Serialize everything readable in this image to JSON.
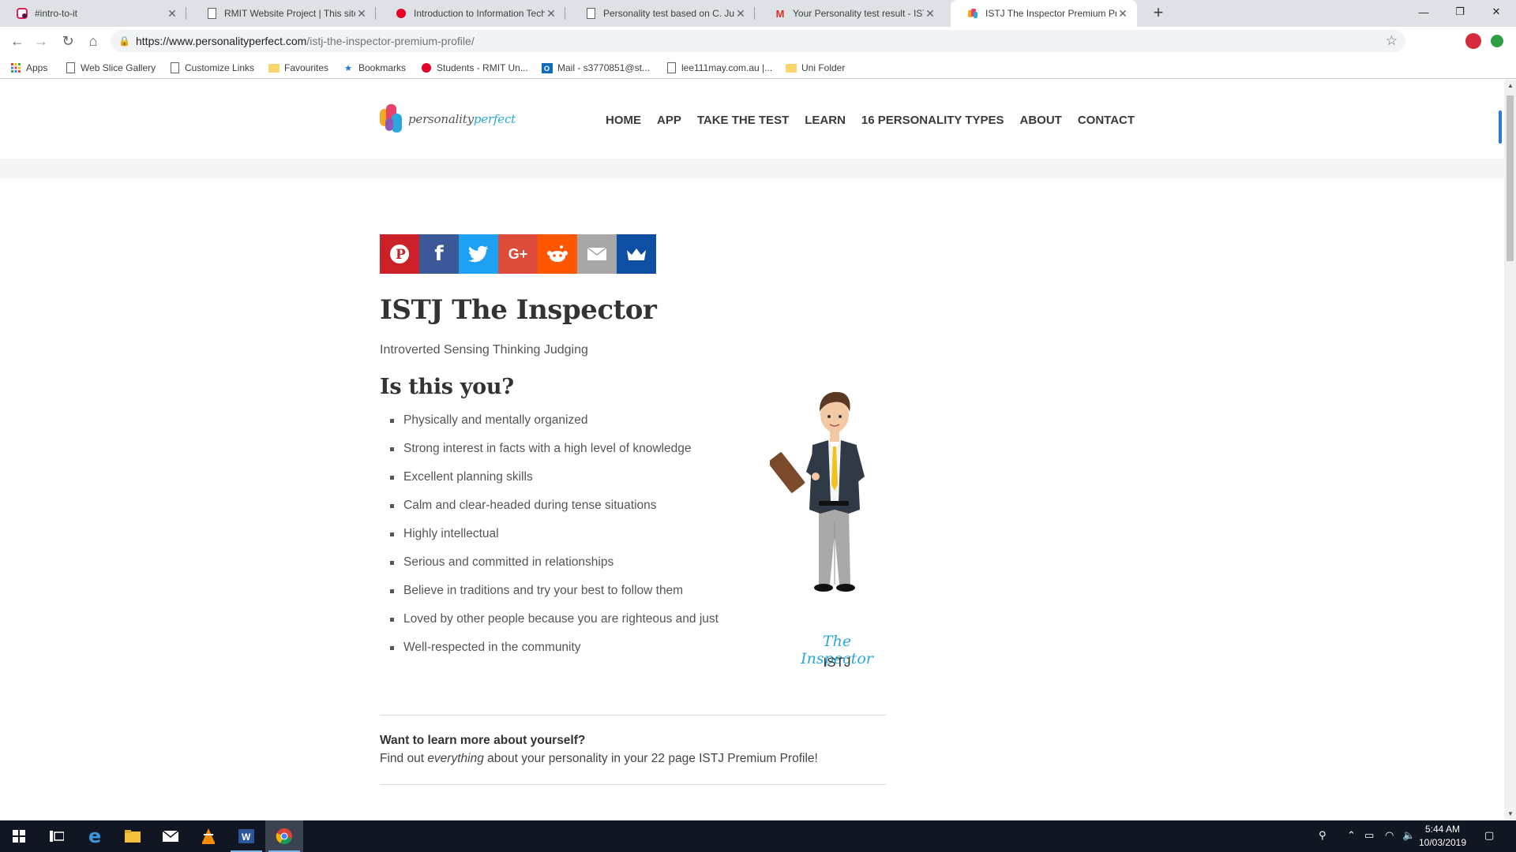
{
  "browser": {
    "tabs": [
      {
        "title": "#intro-to-it",
        "icon": "slack-icon"
      },
      {
        "title": "RMIT Website Project | This site is",
        "icon": "page-icon"
      },
      {
        "title": "Introduction to Information Techn",
        "icon": "rmit-icon"
      },
      {
        "title": "Personality test based on C. Jung",
        "icon": "page-icon"
      },
      {
        "title": "Your Personality test result - ISTJ",
        "icon": "gmail-icon"
      },
      {
        "title": "ISTJ The Inspector Premium Profi",
        "icon": "personality-perfect-icon",
        "active": true
      }
    ],
    "url_host": "https://www.personalityperfect.com",
    "url_path": "/istj-the-inspector-premium-profile/",
    "bookmarks": [
      {
        "label": "Apps",
        "icon": "apps-grid-icon"
      },
      {
        "label": "Web Slice Gallery",
        "icon": "page-icon"
      },
      {
        "label": "Customize Links",
        "icon": "page-icon"
      },
      {
        "label": "Favourites",
        "icon": "folder-icon"
      },
      {
        "label": "Bookmarks",
        "icon": "star-icon"
      },
      {
        "label": "Students - RMIT Un...",
        "icon": "rmit-icon"
      },
      {
        "label": "Mail - s3770851@st...",
        "icon": "outlook-icon"
      },
      {
        "label": "lee111may.com.au |...",
        "icon": "page-icon"
      },
      {
        "label": "Uni Folder",
        "icon": "folder-icon"
      }
    ]
  },
  "site": {
    "logo": {
      "word1": "personality",
      "word2": "perfect"
    },
    "nav": [
      "HOME",
      "APP",
      "TAKE THE TEST",
      "LEARN",
      "16 PERSONALITY TYPES",
      "ABOUT",
      "CONTACT"
    ]
  },
  "share_buttons": [
    {
      "name": "pinterest",
      "glyph": "P",
      "color": "#cb2027"
    },
    {
      "name": "facebook",
      "glyph": "f",
      "color": "#3b5998"
    },
    {
      "name": "twitter",
      "glyph": "🐦",
      "color": "#1da1f2"
    },
    {
      "name": "google-plus",
      "glyph": "G+",
      "color": "#dd4b39"
    },
    {
      "name": "reddit",
      "glyph": "◉",
      "color": "#ff5700"
    },
    {
      "name": "email",
      "glyph": "✉",
      "color": "#a7a7a7"
    },
    {
      "name": "crown",
      "glyph": "♛",
      "color": "#0f4fa3"
    }
  ],
  "profile": {
    "title": "ISTJ The Inspector",
    "subtitle": "Introverted Sensing Thinking Judging",
    "question": "Is this you?",
    "traits": [
      "Physically and mentally organized",
      "Strong interest in facts with a high level of knowledge",
      "Excellent planning skills",
      "Calm and clear-headed during tense situations",
      "Highly intellectual",
      "Serious and committed in relationships",
      "Believe in traditions and try your best to follow them",
      "Loved by other people because you are righteous and just",
      "Well-respected in the community"
    ],
    "figure_caption": "The Inspector",
    "figure_code": "ISTJ"
  },
  "promo": {
    "heading": "Want to learn more about yourself?",
    "text_before": "Find out ",
    "text_em": "everything",
    "text_after": " about your personality in your 22 page ISTJ Premium Profile!"
  },
  "taskbar": {
    "time": "5:44 AM",
    "date": "10/03/2019"
  }
}
